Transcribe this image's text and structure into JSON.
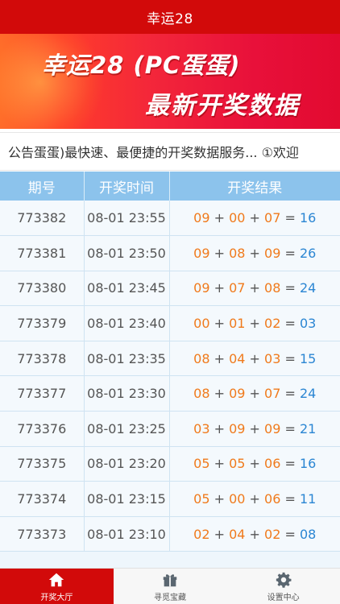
{
  "title": "幸运28",
  "banner": {
    "line1": "幸运28 (PC蛋蛋)",
    "line2": "最新开奖数据"
  },
  "notice": "公告蛋蛋)最快速、最便捷的开奖数据服务... ①欢迎",
  "table": {
    "headers": [
      "期号",
      "开奖时间",
      "开奖结果"
    ],
    "rows": [
      {
        "id": "773382",
        "time": "08-01 23:55",
        "a": "09",
        "b": "00",
        "c": "07",
        "sum": "16"
      },
      {
        "id": "773381",
        "time": "08-01 23:50",
        "a": "09",
        "b": "08",
        "c": "09",
        "sum": "26"
      },
      {
        "id": "773380",
        "time": "08-01 23:45",
        "a": "09",
        "b": "07",
        "c": "08",
        "sum": "24"
      },
      {
        "id": "773379",
        "time": "08-01 23:40",
        "a": "00",
        "b": "01",
        "c": "02",
        "sum": "03"
      },
      {
        "id": "773378",
        "time": "08-01 23:35",
        "a": "08",
        "b": "04",
        "c": "03",
        "sum": "15"
      },
      {
        "id": "773377",
        "time": "08-01 23:30",
        "a": "08",
        "b": "09",
        "c": "07",
        "sum": "24"
      },
      {
        "id": "773376",
        "time": "08-01 23:25",
        "a": "03",
        "b": "09",
        "c": "09",
        "sum": "21"
      },
      {
        "id": "773375",
        "time": "08-01 23:20",
        "a": "05",
        "b": "05",
        "c": "06",
        "sum": "16"
      },
      {
        "id": "773374",
        "time": "08-01 23:15",
        "a": "05",
        "b": "00",
        "c": "06",
        "sum": "11"
      },
      {
        "id": "773373",
        "time": "08-01 23:10",
        "a": "02",
        "b": "04",
        "c": "02",
        "sum": "08"
      }
    ]
  },
  "tabs": [
    {
      "label": "开奖大厅",
      "icon": "home-icon",
      "active": true
    },
    {
      "label": "寻觅宝藏",
      "icon": "gift-icon",
      "active": false
    },
    {
      "label": "设置中心",
      "icon": "gear-icon",
      "active": false
    }
  ],
  "colors": {
    "brand_red": "#d20a0a",
    "header_blue": "#8cc3ec",
    "number_orange": "#f07a1c",
    "sum_blue": "#2b86d3"
  }
}
